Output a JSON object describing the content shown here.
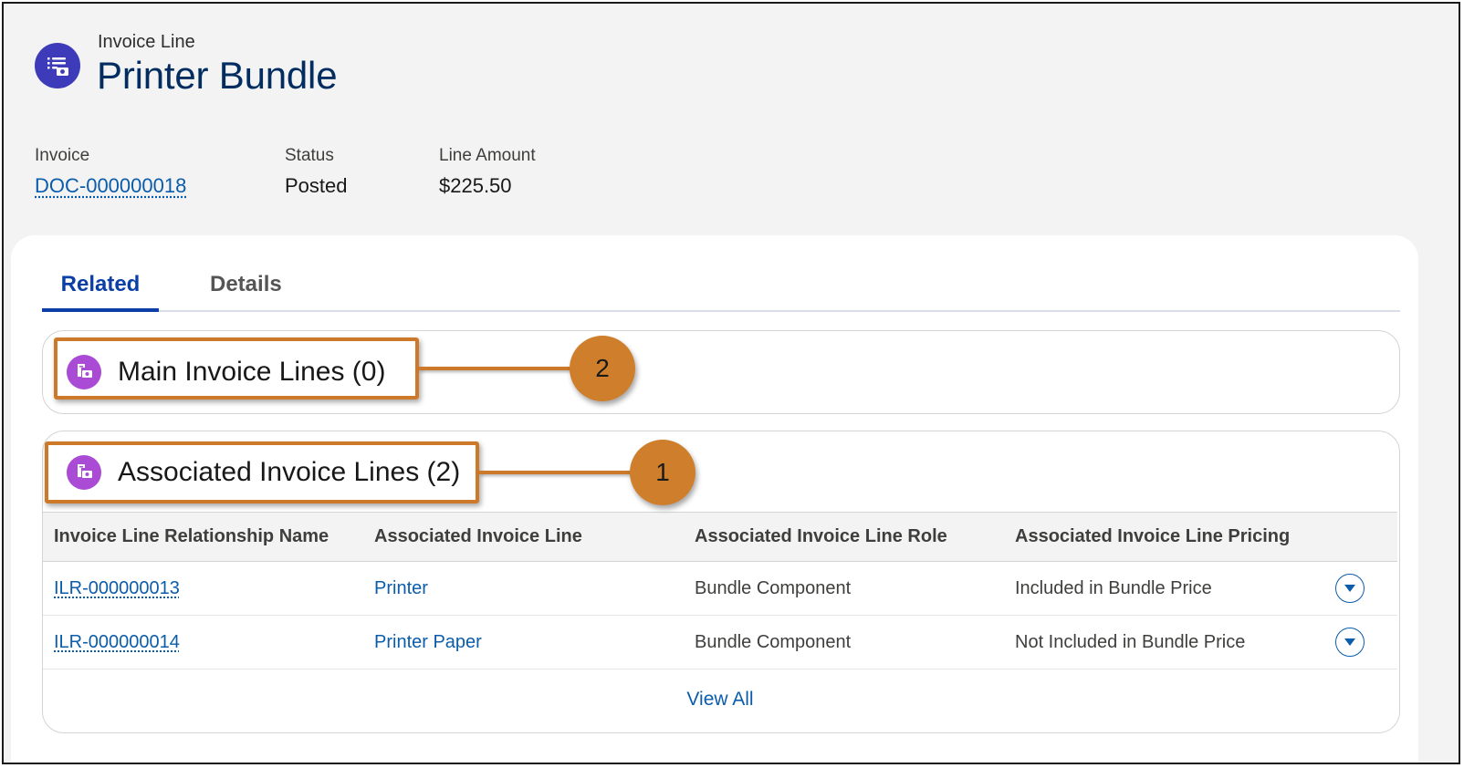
{
  "header": {
    "object_type": "Invoice Line",
    "title": "Printer Bundle",
    "icon": "invoice-line-icon"
  },
  "fields": [
    {
      "label": "Invoice",
      "value": "DOC-000000018"
    },
    {
      "label": "Status",
      "value": "Posted"
    },
    {
      "label": "Line Amount",
      "value": "$225.50"
    }
  ],
  "tabs": [
    {
      "label": "Related",
      "active": true
    },
    {
      "label": "Details",
      "active": false
    }
  ],
  "main_lines": {
    "title": "Main Invoice Lines (0)",
    "callout": "2",
    "icon": "invoice-document-icon"
  },
  "assoc_lines": {
    "title": "Associated Invoice Lines (2)",
    "callout": "1",
    "icon": "invoice-document-icon",
    "columns": [
      "Invoice Line Relationship Name",
      "Associated Invoice Line",
      "Associated Invoice Line Role",
      "Associated Invoice Line Pricing"
    ],
    "rows": [
      [
        "ILR-000000013",
        "Printer",
        "Bundle Component",
        "Included in Bundle Price"
      ],
      [
        "ILR-000000014",
        "Printer Paper",
        "Bundle Component",
        "Not Included in Bundle Price"
      ]
    ],
    "view_all": "View All"
  },
  "colors": {
    "object_icon_bg": "#3d3bb9",
    "related_icon_bg": "#a94bd5",
    "callout": "#cc7a2a",
    "link": "#0b5cab",
    "title": "#032d60"
  }
}
